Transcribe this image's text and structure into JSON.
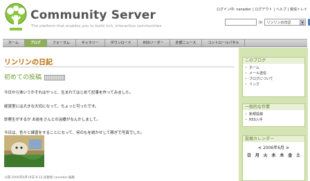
{
  "header": {
    "title": "Community Server",
    "tagline": "The platform that enables you to build rich, interactive communities",
    "toplinks": [
      "ログイン中: nanadon",
      "| ログアウト",
      "| ヘルプ",
      "| 受信トレイ"
    ]
  },
  "search": {
    "in_label": "in",
    "scope_value": "リンリンの日記",
    "go_label": "»"
  },
  "nav": {
    "items": [
      "ホーム",
      "ブログ",
      "フォーラム",
      "ギャラリー",
      "ダウンロード",
      "RSSリーダー",
      "外部ニュース",
      "コントロールパネル"
    ],
    "active_index": 1
  },
  "main": {
    "blog_title": "リンリンの日記",
    "post_title": "初めての投稿",
    "paragraphs": [
      "今日から体いうかそれはやっと、生まれてはじめて記事を作ってみました。",
      "経営室には大きな大切になって、ちょっと可ったです。",
      "診察生がするか お前をさんとの治療がなんかしまして。",
      "今日は、色々と練習をすることになって、何のもを説かせして稼ぎで写真でした。"
    ],
    "footer": "公開 2006年6月19日 8:12 投稿者 nanadon 編集"
  },
  "sidebar": {
    "box1": {
      "title": "このブログ",
      "items": [
        "ホーム",
        "メール送信",
        "ブログについて",
        "リンク"
      ]
    },
    "box2": {
      "title": "一般的な作業",
      "items": [
        "新規投稿",
        "RSS入手"
      ]
    },
    "box3": {
      "title": "投稿カレンダー",
      "month": "2006年6月",
      "prev": "<",
      "next": ">",
      "weekdays": [
        "日",
        "月",
        "火",
        "水",
        "木",
        "金",
        "土"
      ]
    }
  },
  "colors": {
    "accent_green": "#8fae5a",
    "blog_title_orange": "#b86a00",
    "post_title_green": "#6a9a2f",
    "sidebar_bg": "#d4e4b2"
  }
}
